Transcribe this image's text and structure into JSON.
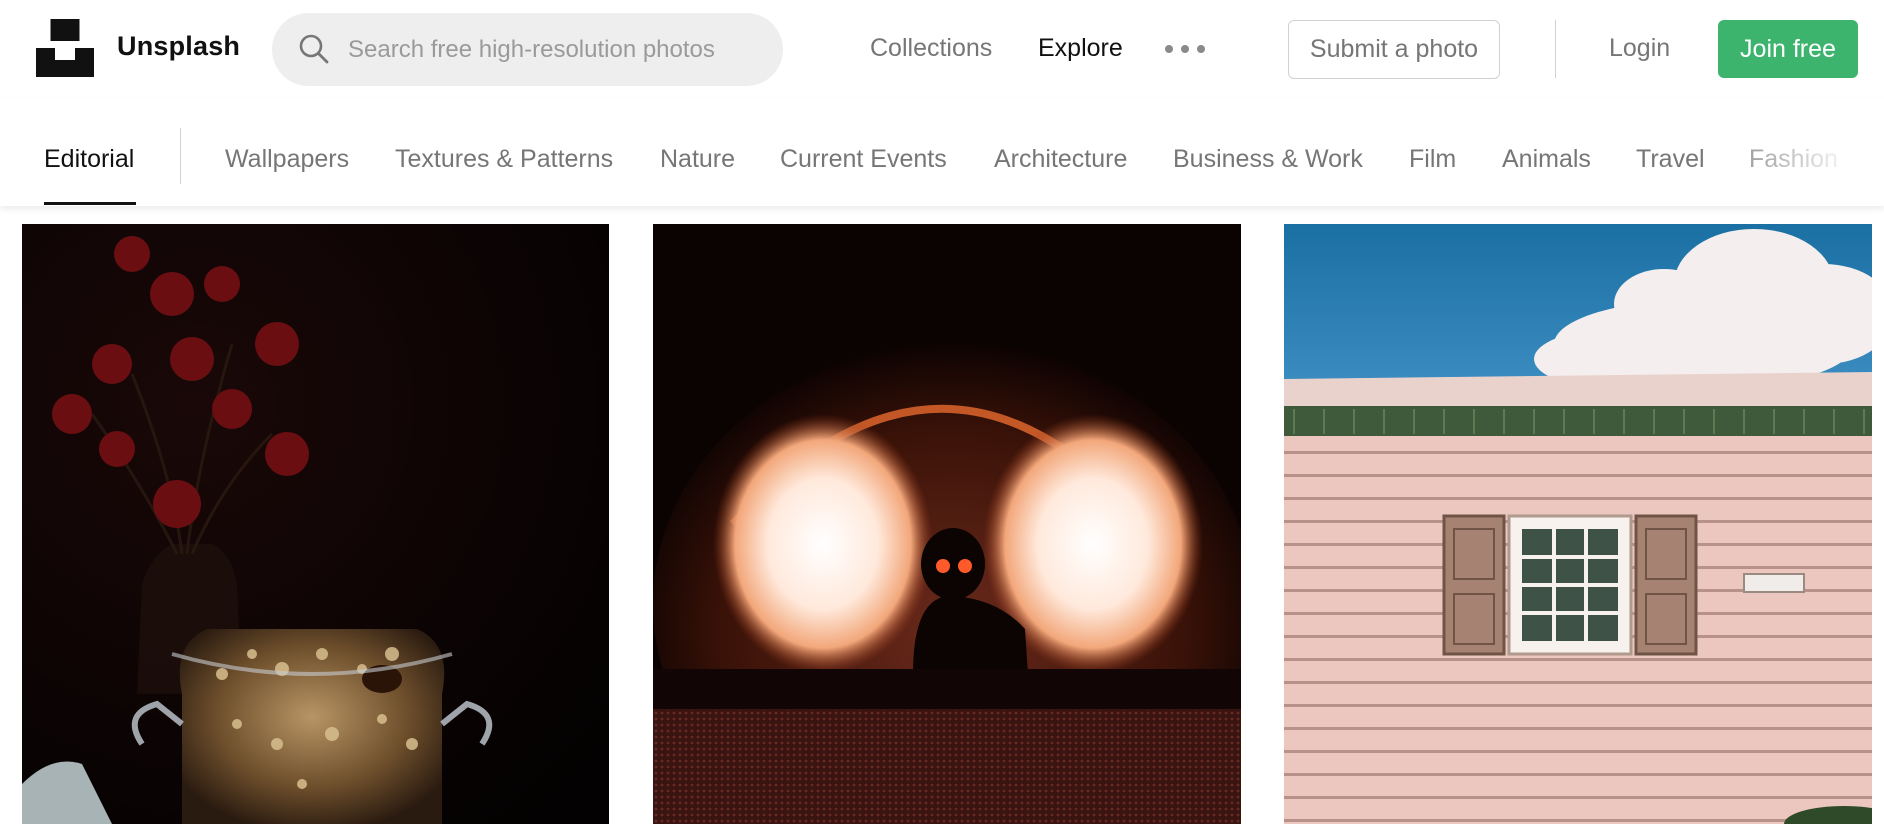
{
  "brand": {
    "name": "Unsplash",
    "logo_icon": "unsplash-logo-icon"
  },
  "search": {
    "placeholder": "Search free high-resolution photos",
    "value": "",
    "icon": "search-icon"
  },
  "nav": {
    "collections": "Collections",
    "explore": "Explore",
    "more_icon": "more-dots-icon",
    "submit": "Submit a photo",
    "login": "Login",
    "join": "Join free"
  },
  "topics": {
    "active": "Editorial",
    "items": [
      "Wallpapers",
      "Textures & Patterns",
      "Nature",
      "Current Events",
      "Architecture",
      "Business & Work",
      "Film",
      "Animals",
      "Travel",
      "Fashion"
    ]
  },
  "colors": {
    "accent": "#3cb46e",
    "text_muted": "#767676",
    "text_primary": "#111111",
    "search_bg": "#eeeeee"
  },
  "photos": [
    {
      "subject": "granola-jar-dark-still-life"
    },
    {
      "subject": "dj-silhouette-stage-lights"
    },
    {
      "subject": "pink-house-window-sky"
    }
  ]
}
